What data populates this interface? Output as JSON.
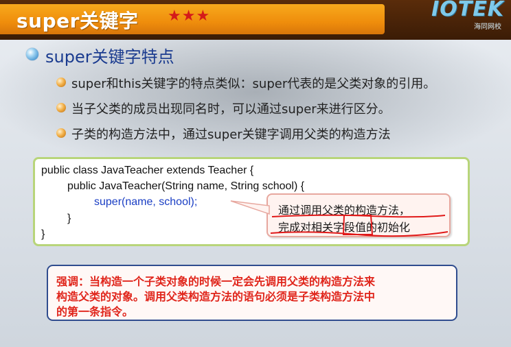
{
  "title": {
    "text": "super关键字",
    "stars": "★★★"
  },
  "logo": {
    "text": "IOTEK",
    "sub": "海同网校"
  },
  "heading": "super关键字特点",
  "bullets": [
    "super和this关键字的特点类似：super代表的是父类对象的引用。",
    "当子父类的成员出现同名时，可以通过super来进行区分。",
    "子类的构造方法中，通过super关键字调用父类的构造方法"
  ],
  "code": {
    "line1": "public class JavaTeacher  extends Teacher {",
    "line2": "public  JavaTeacher(String name, String school) {",
    "line3": "super(name, school);",
    "line4": "}",
    "line5": "}"
  },
  "callout": {
    "line1": "通过调用父类的构造方法，",
    "line2": "完成对相关字段值的初始化"
  },
  "note": {
    "line1": "强调：当构造一个子类对象的时候一定会先调用父类的构造方法来",
    "line2": "构造父类的对象。调用父类构造方法的语句必须是子类构造方法中",
    "line3": "的第一条指令。"
  },
  "colors": {
    "title_bar": "#f39a14",
    "heading": "#1a3b8f",
    "code_border": "#b8d57a",
    "note_text": "#e0251b",
    "note_border": "#2f4c8e",
    "annotation_red": "#e01818"
  }
}
